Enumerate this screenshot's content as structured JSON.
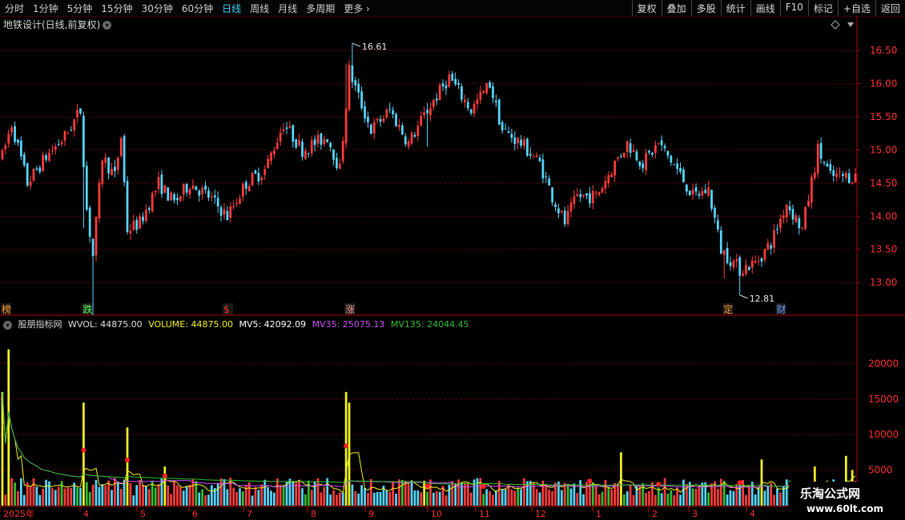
{
  "toolbar": {
    "periods": [
      "分时",
      "1分钟",
      "5分钟",
      "15分钟",
      "30分钟",
      "60分钟",
      "日线",
      "周线",
      "月线",
      "多周期",
      "更多"
    ],
    "active_period": "日线",
    "right_buttons": [
      "复权",
      "叠加",
      "多股",
      "统计",
      "画线",
      "F10",
      "标记",
      "+自选",
      "返回"
    ]
  },
  "title": "地铁设计(日线,前复权)",
  "indicator": {
    "name": "股朋指标网",
    "wvol": "WVOL: 44875.00",
    "volume": "VOLUME: 44875.00",
    "mv5": "MV5: 42092.09",
    "mv35": "MV35: 25075.13",
    "mv135": "MV135: 24044.45"
  },
  "colors": {
    "up": "#ff3c3c",
    "down": "#55d8ff",
    "vol": "#f4f422",
    "mv35": "#d050ff",
    "mv135": "#30c030",
    "grid": "#7a0000"
  },
  "price_axis": [
    "16.50",
    "16.00",
    "15.50",
    "15.00",
    "14.50",
    "14.00",
    "13.50",
    "13.00"
  ],
  "vol_axis": [
    "20000",
    "15000",
    "10000",
    "5000"
  ],
  "time_axis": [
    "2025年",
    "4",
    "5",
    "6",
    "7",
    "8",
    "9",
    "10",
    "11",
    "12",
    "1",
    "2",
    "3",
    "4"
  ],
  "marks": [
    {
      "label": "榜",
      "color": "#ff9a30",
      "day": 0
    },
    {
      "label": "跌",
      "color": "#60ff60",
      "day": 26
    },
    {
      "label": "$",
      "color": "#ff3030",
      "day": 71
    },
    {
      "label": "涨",
      "color": "#ff9a9a",
      "day": 110
    },
    {
      "label": "定",
      "color": "#ff9a30",
      "day": 231
    },
    {
      "label": "财",
      "color": "#6aa0ff",
      "day": 248
    }
  ],
  "price_annotations": [
    {
      "text": "16.61",
      "price": 16.61,
      "day": 112
    },
    {
      "text": "12.81",
      "price": 12.81,
      "day": 236
    }
  ],
  "chart_data": {
    "type": "candlestick",
    "price_ylim": [
      12.7,
      16.9
    ],
    "vol_ylim": [
      0,
      25000
    ],
    "keypoints": [
      [
        0,
        14.9
      ],
      [
        3,
        15.4
      ],
      [
        8,
        14.5
      ],
      [
        14,
        14.9
      ],
      [
        20,
        15.2
      ],
      [
        25,
        15.6
      ],
      [
        27,
        14.1
      ],
      [
        29,
        13.4
      ],
      [
        32,
        14.9
      ],
      [
        36,
        14.6
      ],
      [
        38,
        15.2
      ],
      [
        40,
        13.8
      ],
      [
        44,
        13.9
      ],
      [
        50,
        14.5
      ],
      [
        55,
        14.2
      ],
      [
        60,
        14.5
      ],
      [
        66,
        14.3
      ],
      [
        72,
        14.0
      ],
      [
        78,
        14.5
      ],
      [
        84,
        14.7
      ],
      [
        90,
        15.4
      ],
      [
        96,
        15.0
      ],
      [
        104,
        15.2
      ],
      [
        108,
        14.7
      ],
      [
        111,
        16.2
      ],
      [
        114,
        15.8
      ],
      [
        118,
        15.3
      ],
      [
        124,
        15.6
      ],
      [
        130,
        15.1
      ],
      [
        136,
        15.6
      ],
      [
        143,
        16.1
      ],
      [
        150,
        15.6
      ],
      [
        156,
        16.0
      ],
      [
        160,
        15.3
      ],
      [
        166,
        15.1
      ],
      [
        172,
        14.8
      ],
      [
        176,
        14.3
      ],
      [
        180,
        13.9
      ],
      [
        184,
        14.3
      ],
      [
        190,
        14.3
      ],
      [
        196,
        14.8
      ],
      [
        200,
        15.1
      ],
      [
        205,
        14.8
      ],
      [
        210,
        15.1
      ],
      [
        216,
        14.7
      ],
      [
        221,
        14.3
      ],
      [
        226,
        14.4
      ],
      [
        230,
        13.5
      ],
      [
        236,
        13.2
      ],
      [
        241,
        13.3
      ],
      [
        246,
        13.6
      ],
      [
        251,
        14.2
      ],
      [
        256,
        13.8
      ],
      [
        261,
        15.0
      ],
      [
        265,
        14.6
      ]
    ],
    "events": [
      [
        26,
        -0.9
      ],
      [
        29,
        -0.8
      ],
      [
        110,
        0.6
      ],
      [
        136,
        -0.5
      ],
      [
        231,
        -0.3
      ]
    ],
    "volume_spikes": [
      [
        0,
        16000
      ],
      [
        2,
        22000
      ],
      [
        26,
        14500
      ],
      [
        40,
        11000
      ],
      [
        52,
        5500
      ],
      [
        110,
        16000
      ],
      [
        111,
        14500
      ],
      [
        135,
        3500
      ],
      [
        198,
        7500
      ],
      [
        243,
        6500
      ],
      [
        260,
        5500
      ],
      [
        270,
        7000
      ],
      [
        272,
        5000
      ]
    ],
    "vol_base": 2800
  }
}
